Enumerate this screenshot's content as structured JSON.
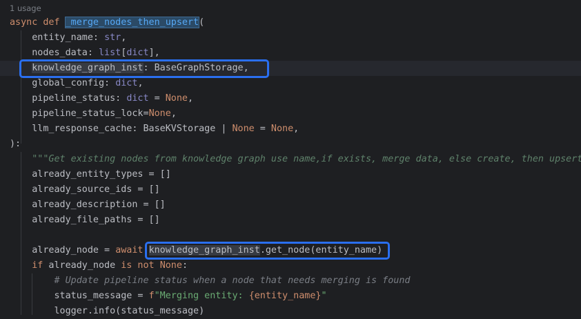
{
  "usage_hint": "1 usage",
  "code": {
    "l1_kw1": "async",
    "l1_kw2": "def",
    "l1_fn": "_merge_nodes_then_upsert",
    "l1_paren": "(",
    "l2": "entity_name: ",
    "l2_t": "str",
    "l2_c": ",",
    "l3": "nodes_data: ",
    "l3_t": "list",
    "l3_b1": "[",
    "l3_t2": "dict",
    "l3_b2": "],",
    "l4_p": "knowledge_graph_inst",
    "l4_r": ": BaseGraphStorage,",
    "l5": "global_config: ",
    "l5_t": "dict",
    "l5_c": ",",
    "l6": "pipeline_status: ",
    "l6_t": "dict",
    "l6_eq": " = ",
    "l6_none": "None",
    "l6_c": ",",
    "l7": "pipeline_status_lock=",
    "l7_none": "None",
    "l7_c": ",",
    "l8": "llm_response_cache: BaseKVStorage | ",
    "l8_none1": "None",
    "l8_eq": " = ",
    "l8_none2": "None",
    "l8_c": ",",
    "l9": "):",
    "l10_doc": "\"\"\"Get existing nodes from knowledge graph use name,if exists, merge data, else create, then upsert.",
    "l11": "already_entity_types = []",
    "l12": "already_source_ids = []",
    "l13": "already_description = []",
    "l14": "already_file_paths = []",
    "l16_a": "already_node = ",
    "l16_kw": "await",
    "l16_sp": " ",
    "l16_ref": "knowledge_graph_inst",
    "l16_b": ".get_node(entity_name)",
    "l17_kw1": "if",
    "l17_a": " already_node ",
    "l17_kw2": "is not",
    "l17_sp": " ",
    "l17_kw3": "None",
    "l17_c": ":",
    "l18_cmt": "# Update pipeline status when a node that needs merging is found",
    "l19_a": "status_message = ",
    "l19_f": "f",
    "l19_s1": "\"Merging entity: ",
    "l19_ref": "{entity_name}",
    "l19_s2": "\"",
    "l20": "logger.info(status_message)"
  },
  "colors": {
    "background": "#1e1f22",
    "keyword": "#cf8e6d",
    "function": "#56a8f5",
    "builtin": "#8888c6",
    "docstring": "#5f826b",
    "comment": "#7a7e85",
    "string": "#6aab73",
    "annotation_box": "#2a6ff0"
  }
}
